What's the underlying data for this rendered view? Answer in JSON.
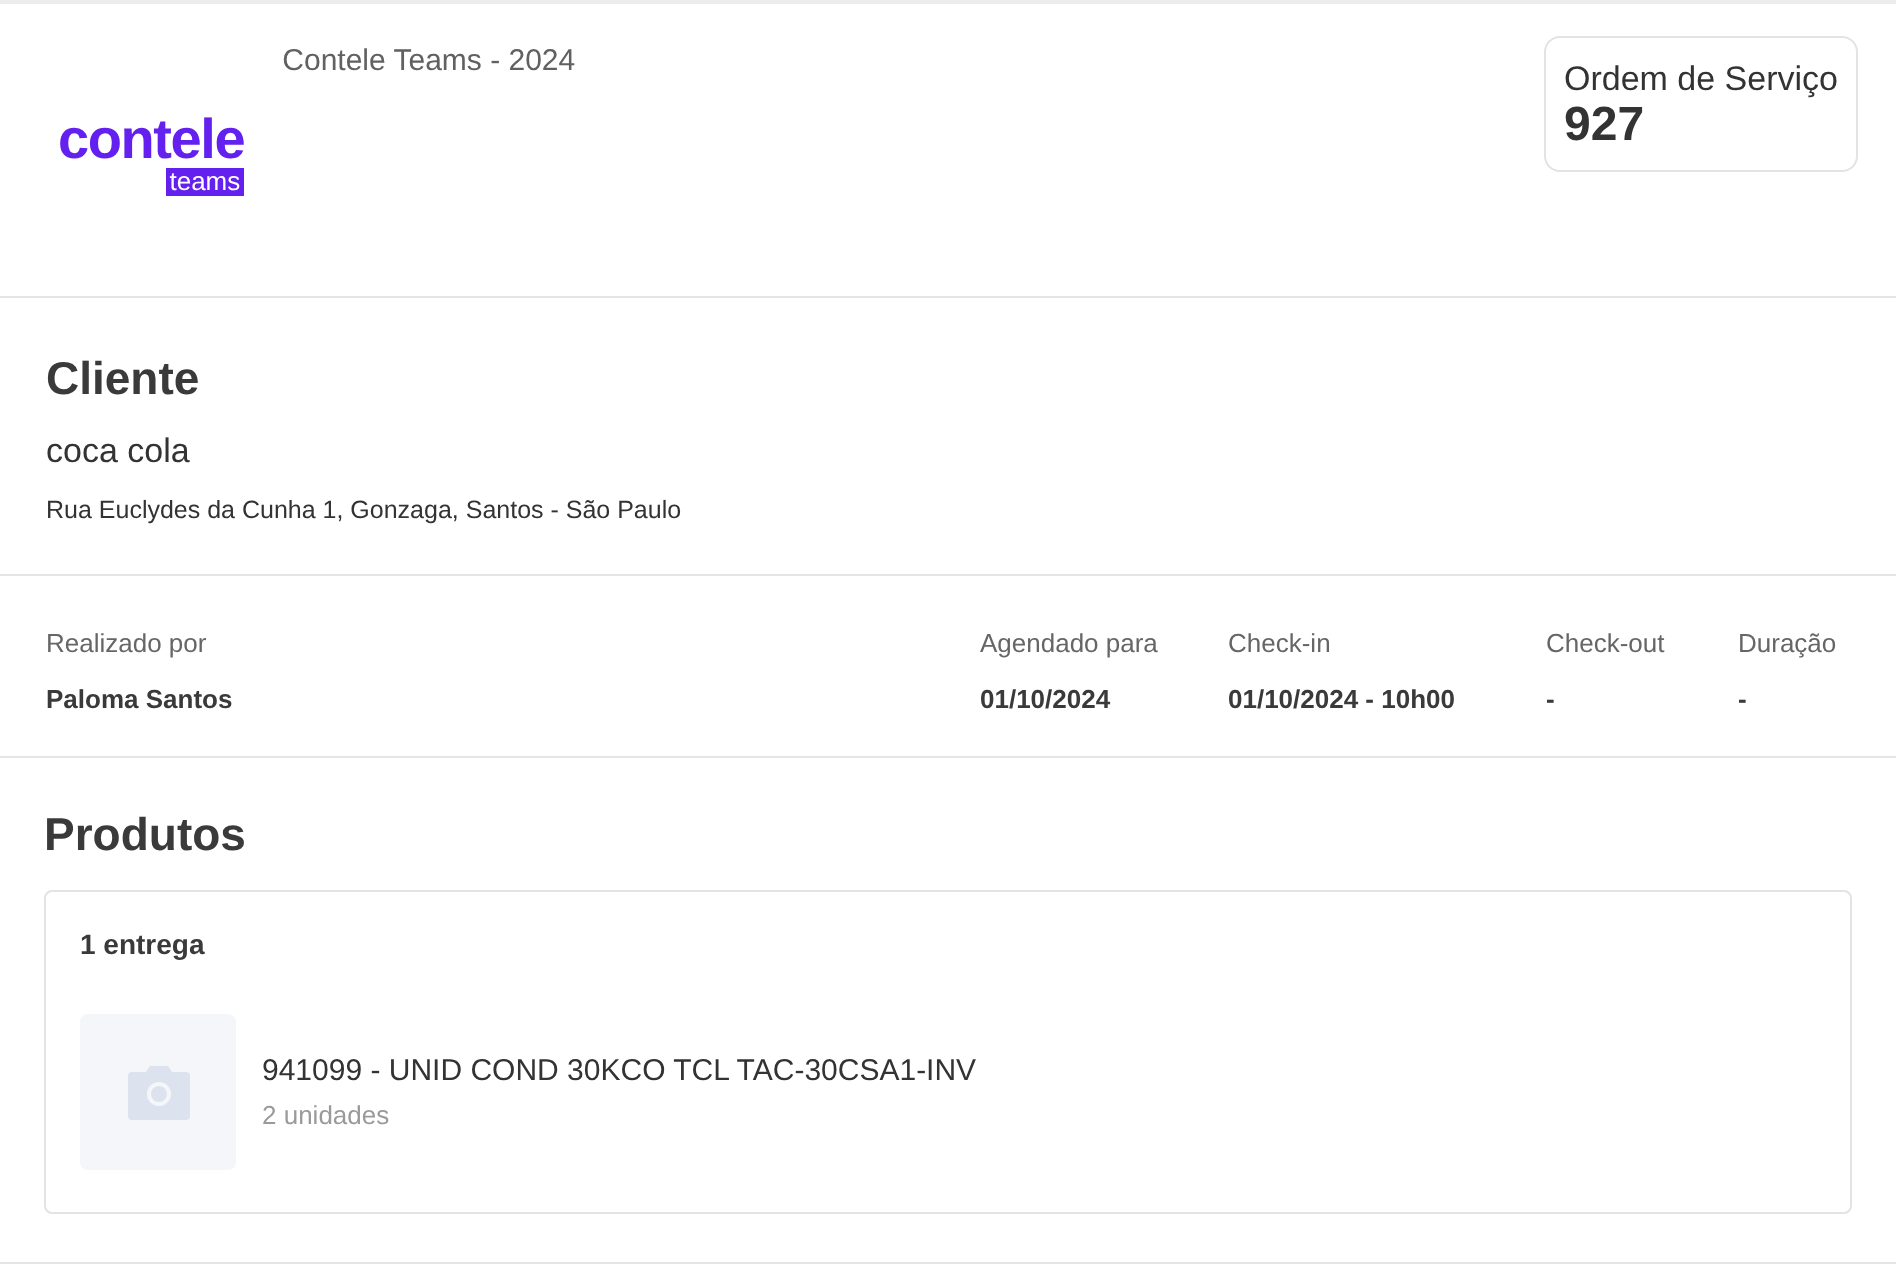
{
  "header": {
    "logo": {
      "word": "contele",
      "tag": "teams"
    },
    "caption": "Contele Teams - 2024",
    "order": {
      "label": "Ordem de Serviço",
      "number": "927"
    }
  },
  "client": {
    "heading": "Cliente",
    "name": "coca cola",
    "address": "Rua Euclydes da Cunha 1, Gonzaga, Santos - São Paulo"
  },
  "details": [
    {
      "label": "Realizado por",
      "value": "Paloma Santos"
    },
    {
      "label": "Agendado para",
      "value": "01/10/2024"
    },
    {
      "label": "Check-in",
      "value": "01/10/2024 - 10h00"
    },
    {
      "label": "Check-out",
      "value": "-"
    },
    {
      "label": "Duração",
      "value": "-"
    }
  ],
  "products": {
    "heading": "Produtos",
    "group": "1 entrega",
    "items": [
      {
        "kind": "picture",
        "name": "941099 - UNID COND 30KCO TCL TAC-30CSA1-INV",
        "quantity": "2 unidades"
      }
    ]
  }
}
